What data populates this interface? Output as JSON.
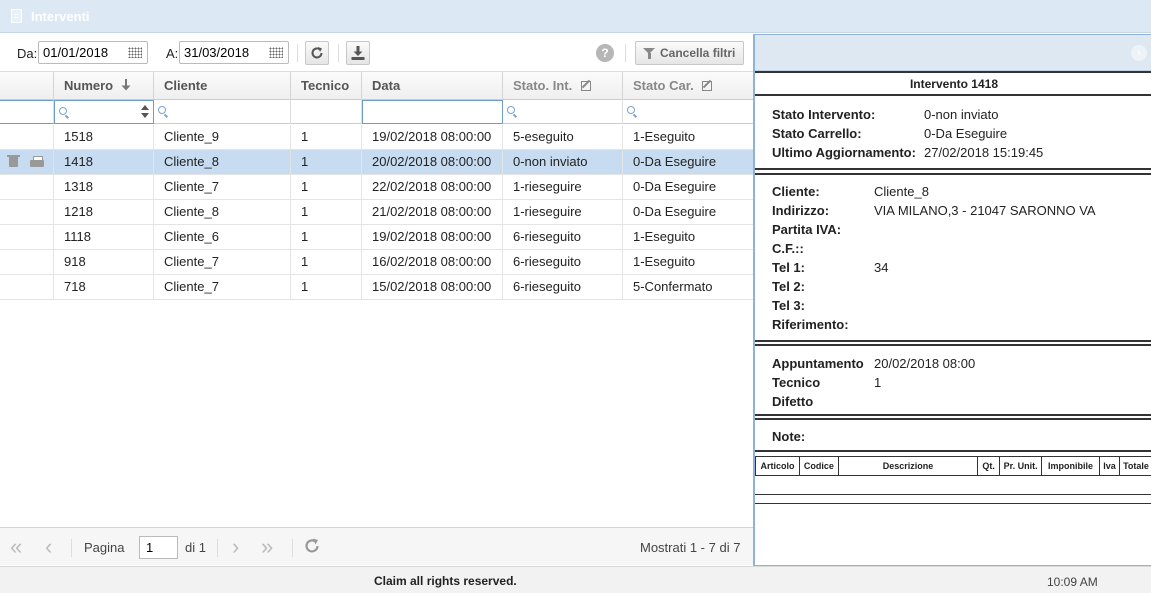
{
  "window": {
    "title": "Interventi",
    "icon": "document-icon"
  },
  "toolbar": {
    "from_label": "Da:",
    "from_value": "01/01/2018",
    "to_label": "A:",
    "to_value": "31/03/2018",
    "refresh_icon": "refresh-icon",
    "download_icon": "download-icon",
    "help_icon": "help-icon",
    "clear_filters_label": "Cancella filtri"
  },
  "grid": {
    "columns": [
      {
        "key": "numero",
        "label": "Numero"
      },
      {
        "key": "cliente",
        "label": "Cliente"
      },
      {
        "key": "tecnico",
        "label": "Tecnico"
      },
      {
        "key": "data",
        "label": "Data"
      },
      {
        "key": "stato_int",
        "label": "Stato. Int."
      },
      {
        "key": "stato_car",
        "label": "Stato Car."
      }
    ],
    "sort": {
      "column": "numero",
      "direction": "desc"
    },
    "rows": [
      {
        "numero": "1518",
        "cliente": "Cliente_9",
        "tecnico": "1",
        "data": "19/02/2018 08:00:00",
        "stato_int": "5-eseguito",
        "stato_car": "1-Eseguito",
        "selected": false
      },
      {
        "numero": "1418",
        "cliente": "Cliente_8",
        "tecnico": "1",
        "data": "20/02/2018 08:00:00",
        "stato_int": "0-non inviato",
        "stato_car": "0-Da Eseguire",
        "selected": true
      },
      {
        "numero": "1318",
        "cliente": "Cliente_7",
        "tecnico": "1",
        "data": "22/02/2018 08:00:00",
        "stato_int": "1-rieseguire",
        "stato_car": "0-Da Eseguire",
        "selected": false
      },
      {
        "numero": "1218",
        "cliente": "Cliente_8",
        "tecnico": "1",
        "data": "21/02/2018 08:00:00",
        "stato_int": "1-rieseguire",
        "stato_car": "0-Da Eseguire",
        "selected": false
      },
      {
        "numero": "1118",
        "cliente": "Cliente_6",
        "tecnico": "1",
        "data": "19/02/2018 08:00:00",
        "stato_int": "6-rieseguito",
        "stato_car": "1-Eseguito",
        "selected": false
      },
      {
        "numero": "918",
        "cliente": "Cliente_7",
        "tecnico": "1",
        "data": "16/02/2018 08:00:00",
        "stato_int": "6-rieseguito",
        "stato_car": "1-Eseguito",
        "selected": false
      },
      {
        "numero": "718",
        "cliente": "Cliente_7",
        "tecnico": "1",
        "data": "15/02/2018 08:00:00",
        "stato_int": "6-rieseguito",
        "stato_car": "5-Confermato",
        "selected": false
      }
    ]
  },
  "pager": {
    "page_label": "Pagina",
    "page_value": "1",
    "of_label": "di 1",
    "summary": "Mostrati 1 - 7 di 7"
  },
  "detail": {
    "title": "Intervento 1418",
    "status": [
      {
        "label": "Stato Intervento:",
        "value": "0-non inviato"
      },
      {
        "label": "Stato Carrello:",
        "value": "0-Da Eseguire"
      },
      {
        "label": "Ultimo Aggiornamento:",
        "value": "27/02/2018 15:19:45"
      }
    ],
    "customer": [
      {
        "label": "Cliente:",
        "value": "Cliente_8"
      },
      {
        "label": "Indirizzo:",
        "value": "VIA MILANO,3 - 21047 SARONNO VA"
      },
      {
        "label": "Partita IVA:",
        "value": ""
      },
      {
        "label": "C.F.::",
        "value": ""
      },
      {
        "label": "Tel 1:",
        "value": "34"
      },
      {
        "label": "Tel 2:",
        "value": ""
      },
      {
        "label": "Tel 3:",
        "value": ""
      },
      {
        "label": "Riferimento:",
        "value": ""
      }
    ],
    "appointment": [
      {
        "label": "Appuntamento",
        "value": "20/02/2018 08:00"
      },
      {
        "label": "Tecnico",
        "value": "1"
      },
      {
        "label": "Difetto",
        "value": ""
      }
    ],
    "notes_label": "Note:",
    "items_columns": [
      "Articolo",
      "Codice",
      "Descrizione",
      "Qt.",
      "Pr. Unit.",
      "Imponibile",
      "Iva",
      "Totale"
    ]
  },
  "footer": {
    "copyright": "Claim all rights reserved.",
    "clock": "10:09 AM"
  }
}
